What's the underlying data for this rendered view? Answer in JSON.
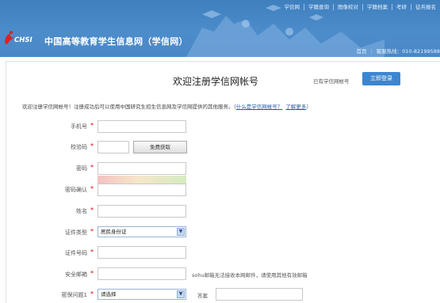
{
  "topnav": [
    "学信网",
    "学籍查询",
    "图像校对",
    "学籍档案",
    "考研",
    "征兵报名"
  ],
  "logo": {
    "chsi": "CHSI",
    "name": "中国高等教育学生信息网（学信网）"
  },
  "subnav": {
    "home": "首页",
    "hotline": "客服热线：010-82199588"
  },
  "page": {
    "title": "欢迎注册学信网帐号",
    "has_account": "已有学信网帐号",
    "login_button": "立即登录",
    "intro": "欢迎注册学信网帐号！注册成功后可以使用中国研究生招生信息网及学信网提供的其他服务。（",
    "intro_link1": "什么是学信网帐号？",
    "intro_link2": "了解更多",
    "intro_end": "）"
  },
  "form": {
    "phone_label": "手机号",
    "code_label": "校验码",
    "code_button": "免费获取",
    "password_label": "密码",
    "confirm_label": "密码确认",
    "name_label": "姓名",
    "idtype_label": "证件类型",
    "idtype_value": "居民身份证",
    "idno_label": "证件号码",
    "email_label": "安全邮箱",
    "email_hint": "sohu邮箱无法接收本网邮件，请使用其他有效邮箱",
    "question_label": "密保问题1",
    "question_value": "请选择",
    "answer_label": "答案",
    "required_mark": "*"
  }
}
